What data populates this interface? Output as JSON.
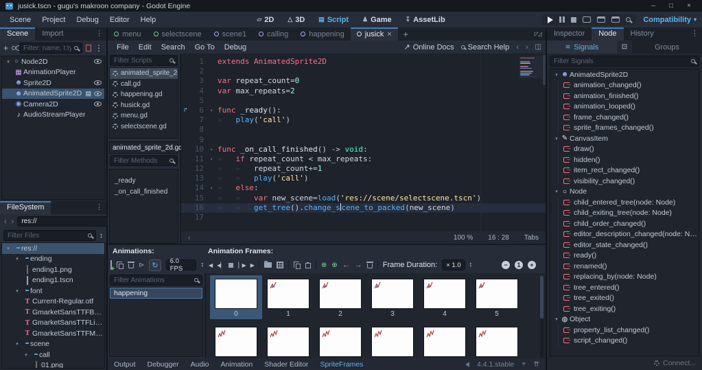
{
  "icons": {
    "vdots": "⋮",
    "chevL": "‹",
    "chevR": "›",
    "plus": "+",
    "close": "×",
    "down": "▾",
    "up": "▴",
    "sort": "↕",
    "expandCorners": "◸◿",
    "panel": "◫",
    "extern": "↗",
    "left": "←",
    "right": "→",
    "loop": "↻",
    "autoplay": "⊳",
    "insert": "⊕",
    "playBack": "◀",
    "playFwd": "▶",
    "framePrev": "◀▏",
    "frameNext": "▏▶",
    "stopSq": "■",
    "minimize": "–",
    "maximize": "□",
    "d2": "▱",
    "d3": "△",
    "script": "▤",
    "game": "♟",
    "assetlib": "↧",
    "connIndicator": "↱",
    "pin": "⌖",
    "raise": "⇈",
    "gridBox": "⊡",
    "waves": "≋"
  },
  "window": {
    "title": "jusick.tscn - gugu's makroon company - Godot Engine"
  },
  "menubar": {
    "items": [
      {
        "label": "Scene"
      },
      {
        "label": "Project"
      },
      {
        "label": "Debug"
      },
      {
        "label": "Editor"
      },
      {
        "label": "Help"
      }
    ],
    "workspaces": [
      {
        "label": "2D",
        "icon": "d2"
      },
      {
        "label": "3D",
        "icon": "d3"
      },
      {
        "label": "Script",
        "icon": "script",
        "active": true
      },
      {
        "label": "Game",
        "icon": "game"
      },
      {
        "label": "AssetLib",
        "icon": "assetlib"
      }
    ],
    "run_mode": "Compatibility"
  },
  "scene_dock": {
    "tabs": [
      {
        "label": "Scene",
        "active": true
      },
      {
        "label": "Import"
      }
    ],
    "filter_placeholder": "Filter: name, t:typ",
    "tree": [
      {
        "label": "Node2D",
        "depth": 0,
        "glyph": "○",
        "color": "#8da5f3",
        "expand": true,
        "eye": true
      },
      {
        "label": "AnimationPlayer",
        "depth": 1,
        "glyph": "▦",
        "color": "#cba1f0"
      },
      {
        "label": "Sprite2D",
        "depth": 1,
        "glyph": "☻",
        "color": "#8da5f3",
        "eye": true
      },
      {
        "label": "AnimatedSprite2D",
        "depth": 1,
        "glyph": "☻",
        "color": "#8da5f3",
        "eye": true,
        "script": true,
        "selected": true
      },
      {
        "label": "Camera2D",
        "depth": 1,
        "glyph": "◉",
        "color": "#8da5f3",
        "eye": true
      },
      {
        "label": "AudioStreamPlayer",
        "depth": 1,
        "glyph": "♪",
        "color": "#e3e8f0"
      }
    ]
  },
  "filesystem": {
    "tab": "FileSystem",
    "path": "res://",
    "filter_placeholder": "Filter Files",
    "tree": [
      {
        "label": "res://",
        "depth": 0,
        "icon": "folder",
        "expand": true,
        "selected": true
      },
      {
        "label": "ending",
        "depth": 1,
        "icon": "folder",
        "expand": true
      },
      {
        "label": "ending1.png",
        "depth": 2,
        "icon": "img"
      },
      {
        "label": "ending1.tscn",
        "depth": 2,
        "icon": "scene"
      },
      {
        "label": "font",
        "depth": 1,
        "icon": "folder",
        "expand": true
      },
      {
        "label": "Current-Regular.otf",
        "depth": 2,
        "icon": "font"
      },
      {
        "label": "GmarketSansTTFBold.ttf",
        "depth": 2,
        "icon": "font"
      },
      {
        "label": "GmarketSansTTFLight.ttf",
        "depth": 2,
        "icon": "font"
      },
      {
        "label": "GmarketSansTTFMedium.ttf",
        "depth": 2,
        "icon": "font"
      },
      {
        "label": "scene",
        "depth": 1,
        "icon": "folder",
        "expand": true
      },
      {
        "label": "call",
        "depth": 2,
        "icon": "folder",
        "expand": true
      },
      {
        "label": "01.png",
        "depth": 3,
        "icon": "img"
      }
    ]
  },
  "scene_tabs": [
    {
      "label": "menu",
      "ring": "#70cf98"
    },
    {
      "label": "selectscene",
      "ring": "#70cf98"
    },
    {
      "label": "scene1",
      "ring": "#9fb4f0"
    },
    {
      "label": "calling",
      "ring": "#9fb4f0"
    },
    {
      "label": "happening",
      "ring": "#9fb4f0"
    },
    {
      "label": "jusick",
      "ring": "#dfe5ee",
      "active": true,
      "closable": true
    }
  ],
  "script_menu": {
    "items": [
      {
        "label": "File"
      },
      {
        "label": "Edit"
      },
      {
        "label": "Search"
      },
      {
        "label": "Go To"
      },
      {
        "label": "Debug"
      }
    ],
    "online_docs": "Online Docs",
    "search_help": "Search Help"
  },
  "scripts_panel": {
    "filter_scripts_placeholder": "Filter Scripts",
    "scripts": [
      {
        "label": "animated_sprite_2d.gd",
        "selected": true
      },
      {
        "label": "call.gd"
      },
      {
        "label": "happening.gd"
      },
      {
        "label": "husick.gd",
        "soft": true
      },
      {
        "label": "menu.gd"
      },
      {
        "label": "selectscene.gd"
      }
    ],
    "current_script": "animated_sprite_2d.gd",
    "filter_methods_placeholder": "Filter Methods",
    "methods": [
      {
        "label": "_ready"
      },
      {
        "label": "_on_call_finished"
      }
    ]
  },
  "code": {
    "lines": [
      {
        "n": "1",
        "tokens": [
          {
            "t": "extends ",
            "cls": "k"
          },
          {
            "t": "AnimatedSprite2D",
            "cls": "k"
          }
        ]
      },
      {
        "n": "2",
        "tokens": []
      },
      {
        "n": "3",
        "tokens": [
          {
            "t": "var ",
            "cls": "k"
          },
          {
            "t": "repeat_count",
            "cls": "i"
          },
          {
            "t": "=",
            "cls": "o"
          },
          {
            "t": "0",
            "cls": "n"
          }
        ]
      },
      {
        "n": "4",
        "tokens": [
          {
            "t": "var ",
            "cls": "k"
          },
          {
            "t": "max_repeats",
            "cls": "i"
          },
          {
            "t": "=",
            "cls": "o"
          },
          {
            "t": "2",
            "cls": "n"
          }
        ]
      },
      {
        "n": "5",
        "tokens": []
      },
      {
        "n": "6",
        "conn": true,
        "fold": true,
        "tokens": [
          {
            "t": "func ",
            "cls": "k"
          },
          {
            "t": "_ready",
            "cls": "d"
          },
          {
            "t": "():",
            "cls": "o"
          }
        ]
      },
      {
        "n": "7",
        "tokens": [
          {
            "t": "»   ",
            "cls": "w"
          },
          {
            "t": "play",
            "cls": "f"
          },
          {
            "t": "(",
            "cls": "o"
          },
          {
            "t": "'call'",
            "cls": "s"
          },
          {
            "t": ")",
            "cls": "o"
          }
        ]
      },
      {
        "n": "8",
        "tokens": []
      },
      {
        "n": "9",
        "tokens": []
      },
      {
        "n": "10",
        "fold": true,
        "tokens": [
          {
            "t": "func ",
            "cls": "k"
          },
          {
            "t": "_on_call_finished",
            "cls": "d"
          },
          {
            "t": "() ",
            "cls": "o"
          },
          {
            "t": "-> ",
            "cls": "o"
          },
          {
            "t": "void",
            "cls": "t"
          },
          {
            "t": ":",
            "cls": "o"
          }
        ]
      },
      {
        "n": "11",
        "fold": true,
        "tokens": [
          {
            "t": "»   ",
            "cls": "w"
          },
          {
            "t": "if ",
            "cls": "k"
          },
          {
            "t": "repeat_count",
            "cls": "i"
          },
          {
            "t": " < ",
            "cls": "o"
          },
          {
            "t": "max_repeats",
            "cls": "i"
          },
          {
            "t": ":",
            "cls": "o"
          }
        ]
      },
      {
        "n": "12",
        "tokens": [
          {
            "t": "»   ",
            "cls": "w"
          },
          {
            "t": "»   ",
            "cls": "w"
          },
          {
            "t": "repeat_count",
            "cls": "i"
          },
          {
            "t": "+=",
            "cls": "o"
          },
          {
            "t": "1",
            "cls": "n"
          }
        ]
      },
      {
        "n": "13",
        "tokens": [
          {
            "t": "»   ",
            "cls": "w"
          },
          {
            "t": "»   ",
            "cls": "w"
          },
          {
            "t": "play",
            "cls": "f"
          },
          {
            "t": "(",
            "cls": "o"
          },
          {
            "t": "'call'",
            "cls": "s"
          },
          {
            "t": ")",
            "cls": "o"
          }
        ]
      },
      {
        "n": "14",
        "fold": true,
        "tokens": [
          {
            "t": "»   ",
            "cls": "w"
          },
          {
            "t": "else",
            "cls": "k"
          },
          {
            "t": ":",
            "cls": "o"
          }
        ]
      },
      {
        "n": "15",
        "tokens": [
          {
            "t": "»   ",
            "cls": "w"
          },
          {
            "t": "»   ",
            "cls": "w"
          },
          {
            "t": "var ",
            "cls": "k"
          },
          {
            "t": "new_scene",
            "cls": "i"
          },
          {
            "t": "=",
            "cls": "o"
          },
          {
            "t": "load",
            "cls": "f"
          },
          {
            "t": "(",
            "cls": "o"
          },
          {
            "t": "'res://scene/selectscene.tscn'",
            "cls": "s"
          },
          {
            "t": ")",
            "cls": "o"
          }
        ]
      },
      {
        "n": "16",
        "current": true,
        "tokens": [
          {
            "t": "»   ",
            "cls": "w"
          },
          {
            "t": "»   ",
            "cls": "w"
          },
          {
            "t": "get_tree",
            "cls": "f"
          },
          {
            "t": "().",
            "cls": "o"
          },
          {
            "t": "change_s",
            "cls": "f"
          },
          {
            "t": "",
            "cls": "c"
          },
          {
            "t": "cene_to_packed",
            "cls": "f"
          },
          {
            "t": "(",
            "cls": "o"
          },
          {
            "t": "new_scene",
            "cls": "i"
          },
          {
            "t": ")",
            "cls": "o"
          }
        ]
      },
      {
        "n": "17",
        "tokens": []
      }
    ],
    "status": {
      "zoom": "100 %",
      "cursor": "16 : 28",
      "indent": "Tabs"
    }
  },
  "anim": {
    "animations_label": "Animations:",
    "frames_label": "Animation Frames:",
    "fps": "6.0 FPS",
    "filter_placeholder": "Filter Animations",
    "animations": [
      {
        "label": "happening",
        "selected": true
      }
    ],
    "frame_duration_label": "Frame Duration:",
    "frame_duration_value": "× 1.0",
    "frames_row1": [
      {
        "n": "0",
        "selected": true
      },
      {
        "n": "1",
        "mark": true
      },
      {
        "n": "2",
        "mark": true
      },
      {
        "n": "3",
        "mark": true
      },
      {
        "n": "4",
        "mark": true
      },
      {
        "n": "5",
        "mark": true
      }
    ],
    "frames_row2": [
      {
        "mark": true
      },
      {
        "mark": true
      },
      {
        "mark": true
      },
      {
        "mark": true
      },
      {
        "mark": true
      },
      {
        "mark": true
      }
    ]
  },
  "bottom_bar": {
    "items": [
      {
        "label": "Output"
      },
      {
        "label": "Debugger"
      },
      {
        "label": "Audio"
      },
      {
        "label": "Animation"
      },
      {
        "label": "Shader Editor"
      },
      {
        "label": "SpriteFrames",
        "active": true
      }
    ],
    "version": "4.4.1.stable"
  },
  "node_dock": {
    "tabs": [
      {
        "label": "Inspector"
      },
      {
        "label": "Node",
        "active": true
      },
      {
        "label": "History"
      }
    ],
    "signals_tab": "Signals",
    "groups_tab": "Groups",
    "filter_placeholder": "Filter Signals",
    "groups": [
      {
        "label": "AnimatedSprite2D",
        "glyph": "☻",
        "color": "#8da5f3",
        "signals": [
          {
            "label": "animation_changed()"
          },
          {
            "label": "animation_finished()"
          },
          {
            "label": "animation_looped()"
          },
          {
            "label": "frame_changed()"
          },
          {
            "label": "sprite_frames_changed()"
          }
        ]
      },
      {
        "label": "CanvasItem",
        "glyph": "✎",
        "color": "#e3e8f0",
        "signals": [
          {
            "label": "draw()"
          },
          {
            "label": "hidden()"
          },
          {
            "label": "item_rect_changed()"
          },
          {
            "label": "visibility_changed()"
          }
        ]
      },
      {
        "label": "Node",
        "glyph": "○",
        "color": "#e3e8f0",
        "signals": [
          {
            "label": "child_entered_tree(node: Node)"
          },
          {
            "label": "child_exiting_tree(node: Node)"
          },
          {
            "label": "child_order_changed()"
          },
          {
            "label": "editor_description_changed(node: Node)"
          },
          {
            "label": "editor_state_changed()"
          },
          {
            "label": "ready()"
          },
          {
            "label": "renamed()"
          },
          {
            "label": "replacing_by(node: Node)"
          },
          {
            "label": "tree_entered()"
          },
          {
            "label": "tree_exited()"
          },
          {
            "label": "tree_exiting()"
          }
        ]
      },
      {
        "label": "Object",
        "glyph": "◍",
        "color": "#e3e8f0",
        "signals": [
          {
            "label": "property_list_changed()"
          },
          {
            "label": "script_changed()"
          }
        ]
      }
    ],
    "connect_label": "Connect..."
  }
}
